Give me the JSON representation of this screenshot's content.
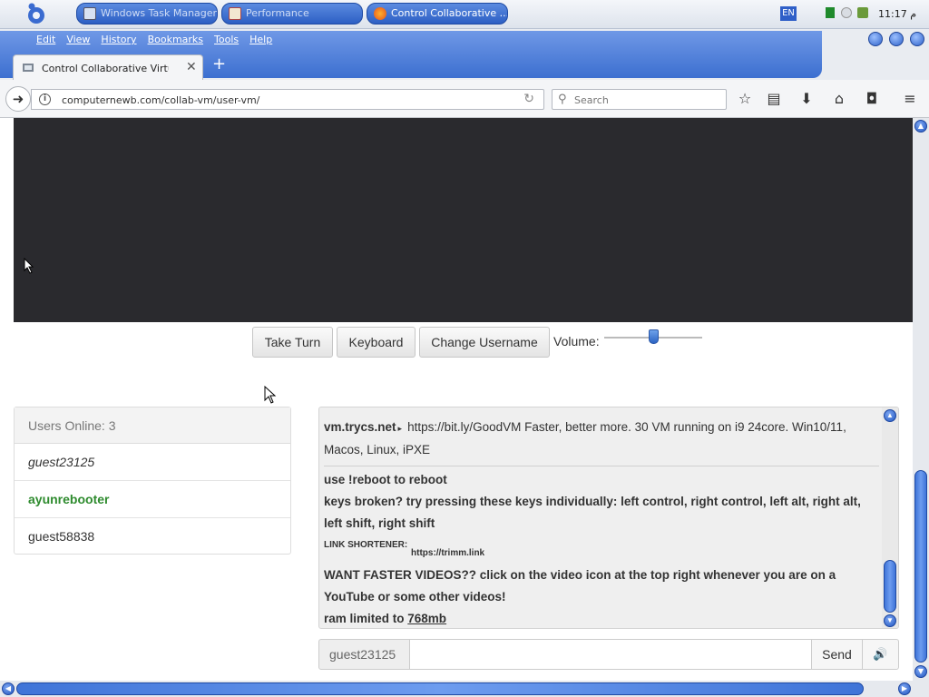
{
  "taskbar": {
    "tasks": [
      {
        "label": "Windows Task Manager"
      },
      {
        "label": "Performance"
      },
      {
        "label": "Control Collaborative ..."
      }
    ],
    "language": "EN",
    "clock": "11:17 م"
  },
  "browser": {
    "menu": [
      "Edit",
      "View",
      "History",
      "Bookmarks",
      "Tools",
      "Help"
    ],
    "tab_title": "Control Collaborative Virtual ...",
    "url": "computernewb.com/collab-vm/user-vm/",
    "search_placeholder": "Search"
  },
  "vm_controls": {
    "take_turn": "Take Turn",
    "keyboard": "Keyboard",
    "change_username": "Change Username",
    "volume_label": "Volume:",
    "volume_level": 0.5
  },
  "users": {
    "header": "Users Online: 3",
    "list": [
      {
        "name": "guest23125"
      },
      {
        "name": "ayunrebooter"
      },
      {
        "name": "guest58838"
      }
    ]
  },
  "chat": {
    "motd_host": "vm.trycs.net",
    "motd_arrow": "▸",
    "motd_text": "https://bit.ly/GoodVM Faster, better more. 30 VM running on i9 24core. Win10/11, Macos, Linux, iPXE",
    "line1": "use !reboot to reboot",
    "line2": "keys broken? try pressing these keys individually: left control, right control, left alt, right alt, left shift, right shift",
    "shortener_label": "LINK SHORTENER:",
    "shortener_url": "https://trimm.link",
    "line4": "WANT FASTER VIDEOS?? click on the video icon at the top right whenever you are on a YouTube or some other videos!",
    "ram_prefix": "ram limited to",
    "ram_value": "768mb",
    "input_username": "guest23125",
    "send_label": "Send"
  },
  "colors": {
    "taskbar_button": "#3a6ccf",
    "vm_screen": "#2a2a2e",
    "active_user": "#2e8b2e",
    "scroll_accent": "#3f74d8"
  }
}
